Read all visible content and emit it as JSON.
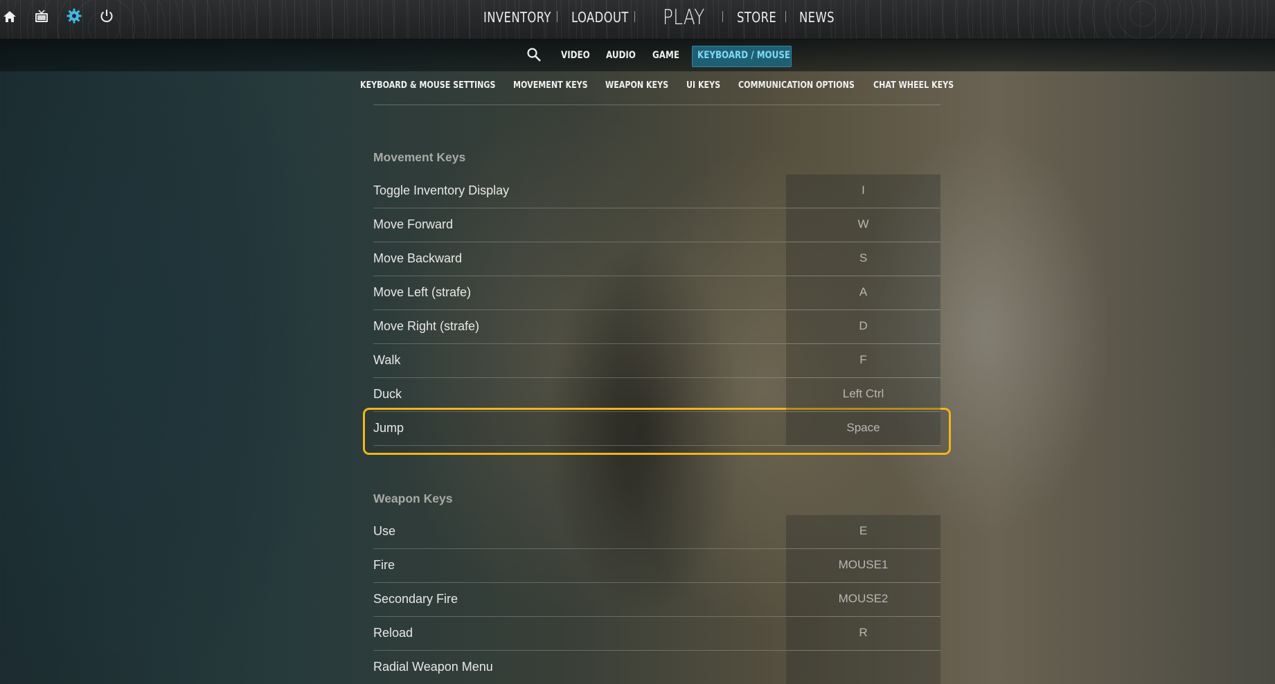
{
  "topnav": {
    "items": [
      "INVENTORY",
      "LOADOUT",
      "PLAY",
      "STORE",
      "NEWS"
    ],
    "icons": [
      "home-icon",
      "tv-icon",
      "gear-icon",
      "power-icon"
    ],
    "active_icon_color": "#3fb9e6"
  },
  "subnav": {
    "items": [
      "VIDEO",
      "AUDIO",
      "GAME",
      "KEYBOARD / MOUSE"
    ],
    "active": "KEYBOARD / MOUSE",
    "active_bg": "#1f5f74",
    "active_text": "#7fd8f6"
  },
  "section_tabs": [
    "KEYBOARD & MOUSE SETTINGS",
    "MOVEMENT KEYS",
    "WEAPON KEYS",
    "UI KEYS",
    "COMMUNICATION OPTIONS",
    "CHAT WHEEL KEYS"
  ],
  "movement": {
    "title": "Movement Keys",
    "rows": [
      {
        "label": "Toggle Inventory Display",
        "key": "I"
      },
      {
        "label": "Move Forward",
        "key": "W"
      },
      {
        "label": "Move Backward",
        "key": "S"
      },
      {
        "label": "Move Left (strafe)",
        "key": "A"
      },
      {
        "label": "Move Right (strafe)",
        "key": "D"
      },
      {
        "label": "Walk",
        "key": "F"
      },
      {
        "label": "Duck",
        "key": "Left Ctrl"
      },
      {
        "label": "Jump",
        "key": "Space"
      }
    ]
  },
  "weapon": {
    "title": "Weapon Keys",
    "rows": [
      {
        "label": "Use",
        "key": "E"
      },
      {
        "label": "Fire",
        "key": "MOUSE1"
      },
      {
        "label": "Secondary Fire",
        "key": "MOUSE2"
      },
      {
        "label": "Reload",
        "key": "R"
      },
      {
        "label": "Radial Weapon Menu",
        "key": ""
      }
    ]
  },
  "highlight_color": "#f2b51b"
}
